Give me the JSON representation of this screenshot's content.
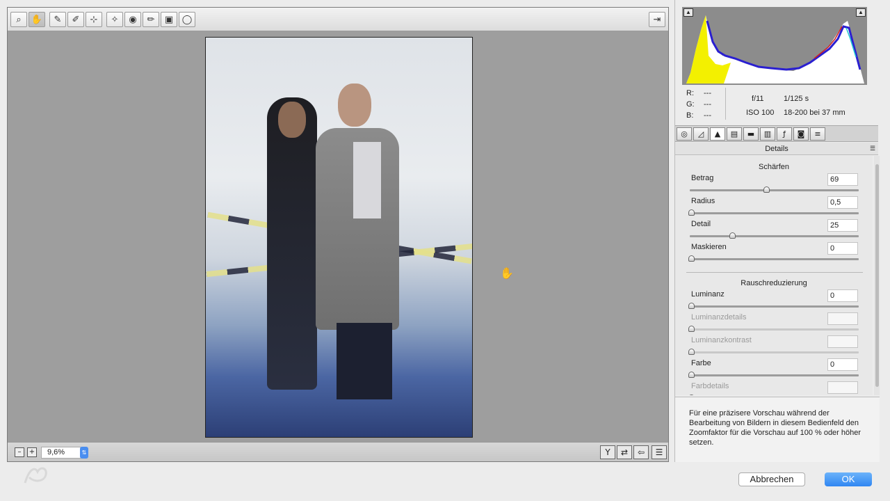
{
  "toolbar": {
    "tools": [
      {
        "name": "zoom-tool",
        "icon": "magnifier-icon",
        "glyph": "⌕",
        "active": false
      },
      {
        "name": "hand-tool",
        "icon": "hand-icon",
        "glyph": "✋",
        "active": true
      },
      {
        "name": "white-balance-tool",
        "icon": "eyedropper-icon",
        "glyph": "✎",
        "active": false
      },
      {
        "name": "color-sampler-tool",
        "icon": "eyedropper-plus-icon",
        "glyph": "✐",
        "active": false
      },
      {
        "name": "targeted-adjustment-tool",
        "icon": "target-adjust-icon",
        "glyph": "⊹",
        "active": false
      },
      {
        "name": "spot-removal-tool",
        "icon": "spot-removal-icon",
        "glyph": "✧",
        "active": false
      },
      {
        "name": "red-eye-tool",
        "icon": "eye-icon",
        "glyph": "◉",
        "active": false
      },
      {
        "name": "adjustment-brush-tool",
        "icon": "brush-icon",
        "glyph": "✏",
        "active": false
      },
      {
        "name": "graduated-filter-tool",
        "icon": "graduated-filter-icon",
        "glyph": "▣",
        "active": false
      },
      {
        "name": "radial-filter-tool",
        "icon": "radial-filter-icon",
        "glyph": "◯",
        "active": false
      }
    ],
    "open_object_icon": "export-icon"
  },
  "statusbar": {
    "zoom_value": "9,6%",
    "zoom_out_label": "–",
    "zoom_in_label": "+"
  },
  "info": {
    "r_label": "R:",
    "r_value": "---",
    "g_label": "G:",
    "g_value": "---",
    "b_label": "B:",
    "b_value": "---",
    "aperture": "f/11",
    "shutter": "1/125 s",
    "iso": "ISO 100",
    "lens": "18-200 bei 37 mm"
  },
  "panel": {
    "title": "Details",
    "sharpen_heading": "Schärfen",
    "noise_heading": "Rauschreduzierung",
    "sliders": [
      {
        "label": "Betrag",
        "value": "69",
        "pos": 0.46,
        "enabled": true
      },
      {
        "label": "Radius",
        "value": "0,5",
        "pos": 0.0,
        "enabled": true
      },
      {
        "label": "Detail",
        "value": "25",
        "pos": 0.25,
        "enabled": true
      },
      {
        "label": "Maskieren",
        "value": "0",
        "pos": 0.0,
        "enabled": true
      },
      {
        "label": "Luminanz",
        "value": "0",
        "pos": 0.0,
        "enabled": true
      },
      {
        "label": "Luminanzdetails",
        "value": "",
        "pos": 0.0,
        "enabled": false
      },
      {
        "label": "Luminanzkontrast",
        "value": "",
        "pos": 0.0,
        "enabled": false
      },
      {
        "label": "Farbe",
        "value": "0",
        "pos": 0.0,
        "enabled": true
      },
      {
        "label": "Farbdetails",
        "value": "",
        "pos": 0.0,
        "enabled": false
      }
    ],
    "hint": "Für eine präzisere Vorschau während der Bearbeitung von Bildern in diesem Bedienfeld den Zoomfaktor für die Vorschau auf 100 % oder höher setzen."
  },
  "footer": {
    "cancel_label": "Abbrechen",
    "ok_label": "OK"
  }
}
